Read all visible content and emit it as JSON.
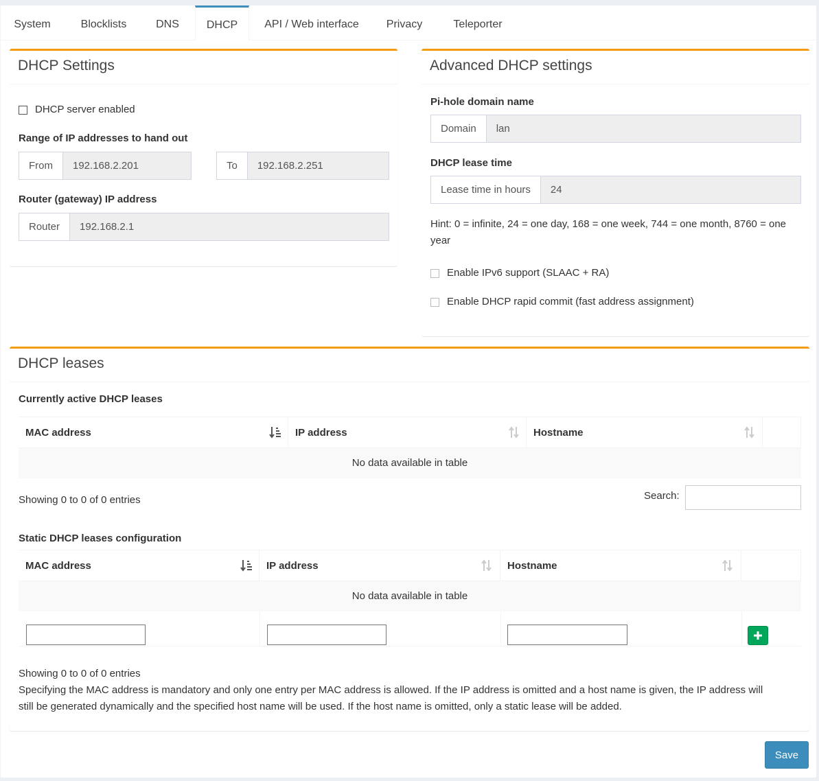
{
  "tabs": [
    {
      "label": "System"
    },
    {
      "label": "Blocklists"
    },
    {
      "label": "DNS"
    },
    {
      "label": "DHCP",
      "active": true
    },
    {
      "label": "API / Web interface"
    },
    {
      "label": "Privacy"
    },
    {
      "label": "Teleporter"
    }
  ],
  "dhcp_settings": {
    "title": "DHCP Settings",
    "server_enabled_label": "DHCP server enabled",
    "server_enabled": false,
    "range_label": "Range of IP addresses to hand out",
    "from_addon": "From",
    "from_value": "192.168.2.201",
    "to_addon": "To",
    "to_value": "192.168.2.251",
    "router_label": "Router (gateway) IP address",
    "router_addon": "Router",
    "router_value": "192.168.2.1"
  },
  "advanced": {
    "title": "Advanced DHCP settings",
    "domain_label": "Pi-hole domain name",
    "domain_addon": "Domain",
    "domain_value": "lan",
    "lease_label": "DHCP lease time",
    "lease_addon": "Lease time in hours",
    "lease_value": "24",
    "hint_line1": "Hint: 0 = infinite, 24 = one day, 168 = one week, 744 = one month, 8760 = one",
    "hint_line2": "year",
    "ipv6_label": "Enable IPv6 support (SLAAC + RA)",
    "rapid_label": "Enable DHCP rapid commit (fast address assignment)"
  },
  "leases": {
    "title": "DHCP leases",
    "active_heading": "Currently active DHCP leases",
    "columns": [
      "MAC address",
      "IP address",
      "Hostname"
    ],
    "empty_text": "No data available in table",
    "showing_text": "Showing 0 to 0 of 0 entries",
    "search_label": "Search:",
    "static_heading": "Static DHCP leases configuration",
    "static_columns": [
      "MAC address",
      "IP address",
      "Hostname"
    ],
    "static_empty_text": "No data available in table",
    "static_showing_text": "Showing 0 to 0 of 0 entries",
    "note_line1": "Specifying the MAC address is mandatory and only one entry per MAC address is allowed. If the IP address is omitted and a host name is given, the IP address will",
    "note_line2": "still be generated dynamically and the specified host name will be used. If the host name is omitted, only a static lease will be added."
  },
  "save_label": "Save",
  "colors": {
    "accent_box": "#f39c12",
    "tab_active": "#3c8dbc",
    "add_button": "#00a65a",
    "save_button": "#3c8dbc"
  }
}
